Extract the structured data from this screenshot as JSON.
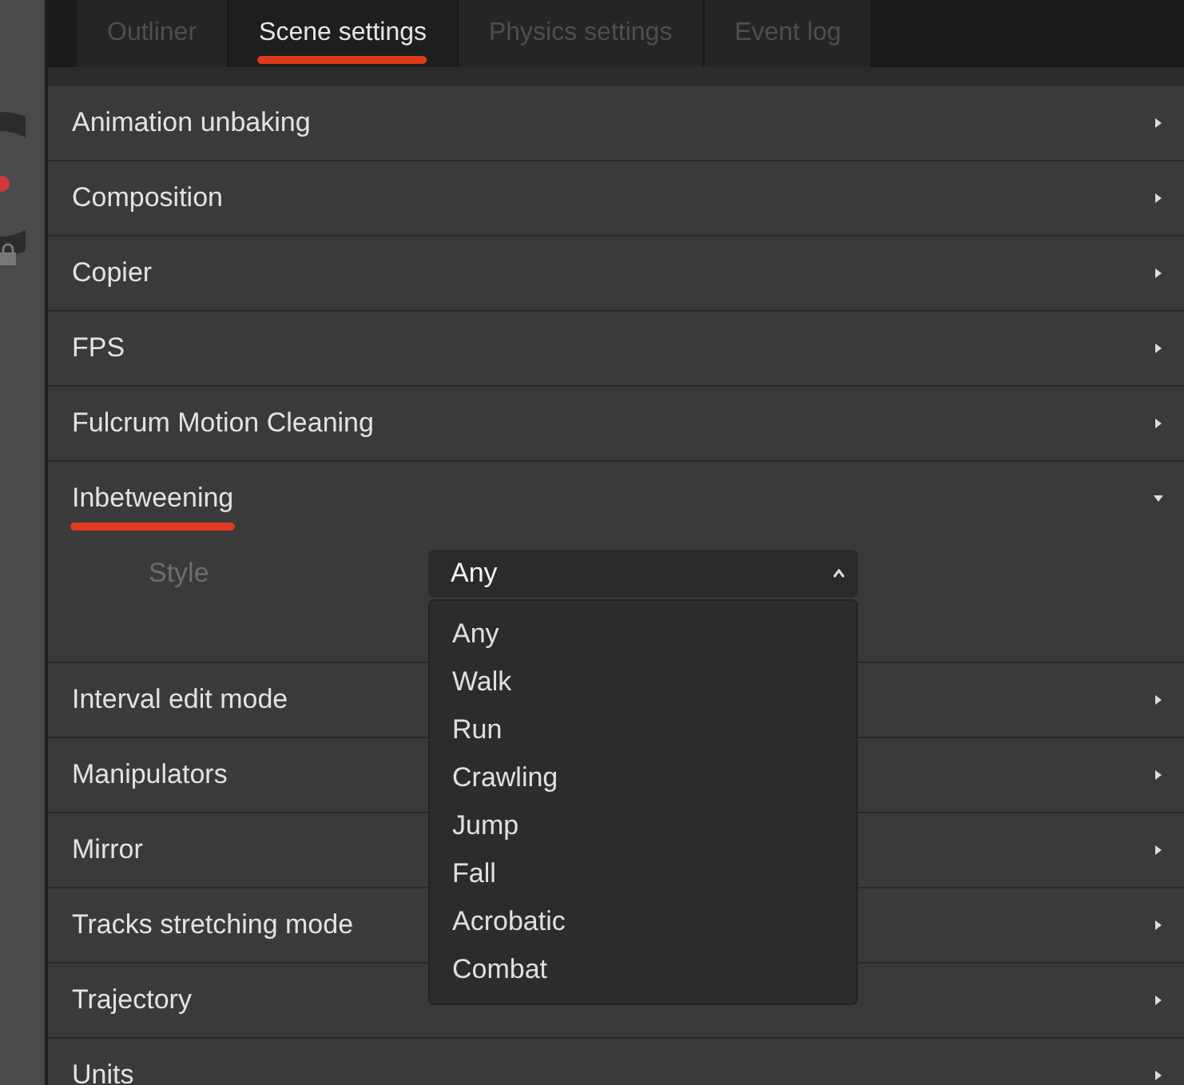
{
  "tabs": [
    {
      "label": "Outliner",
      "selected": false
    },
    {
      "label": "Scene settings",
      "selected": true
    },
    {
      "label": "Physics settings",
      "selected": false
    },
    {
      "label": "Event log",
      "selected": false
    }
  ],
  "sections": [
    {
      "title": "Animation unbaking",
      "expanded": false,
      "annotated": false
    },
    {
      "title": "Composition",
      "expanded": false,
      "annotated": false
    },
    {
      "title": "Copier",
      "expanded": false,
      "annotated": false
    },
    {
      "title": "FPS",
      "expanded": false,
      "annotated": false
    },
    {
      "title": "Fulcrum Motion Cleaning",
      "expanded": false,
      "annotated": false
    },
    {
      "title": "Inbetweening",
      "expanded": true,
      "annotated": true,
      "fields": [
        {
          "label": "Style",
          "value": "Any",
          "open": true,
          "options": [
            {
              "label": "Any"
            },
            {
              "label": "Walk"
            },
            {
              "label": "Run"
            },
            {
              "label": "Crawling"
            },
            {
              "label": "Jump"
            },
            {
              "label": "Fall"
            },
            {
              "label": "Acrobatic"
            },
            {
              "label": "Combat"
            }
          ]
        }
      ]
    },
    {
      "title": "Interval edit mode",
      "expanded": false,
      "annotated": false
    },
    {
      "title": "Manipulators",
      "expanded": false,
      "annotated": false
    },
    {
      "title": "Mirror",
      "expanded": false,
      "annotated": false
    },
    {
      "title": "Tracks stretching mode",
      "expanded": false,
      "annotated": false
    },
    {
      "title": "Trajectory",
      "expanded": false,
      "annotated": false
    },
    {
      "title": "Units",
      "expanded": false,
      "annotated": false
    }
  ]
}
